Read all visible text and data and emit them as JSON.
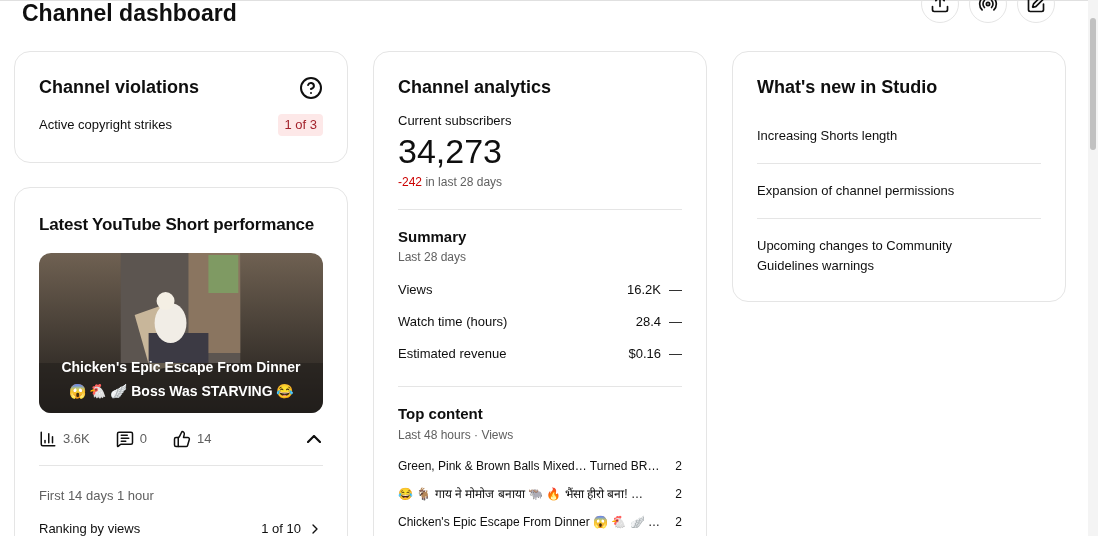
{
  "page_title": "Channel dashboard",
  "header_actions": [
    {
      "kind": "upload"
    },
    {
      "kind": "live"
    },
    {
      "kind": "edit"
    }
  ],
  "violations": {
    "title": "Channel violations",
    "label": "Active copyright strikes",
    "badge": "1 of 3"
  },
  "short": {
    "title": "Latest YouTube Short performance",
    "video_title": "Chicken's Epic Escape From Dinner 😱 🐔 🪽 Boss Was STARVING 😂",
    "stats": [
      {
        "kind": "views",
        "value": "3.6K"
      },
      {
        "kind": "comments",
        "value": "0"
      },
      {
        "kind": "likes",
        "value": "14"
      }
    ],
    "expanded": true,
    "period": "First 14 days 1 hour",
    "ranking_label": "Ranking by views",
    "ranking_value": "1 of 10"
  },
  "analytics": {
    "title": "Channel analytics",
    "subscribers_label": "Current subscribers",
    "subscribers": "34,273",
    "change": "-242",
    "change_suffix": "in last 28 days",
    "summary": {
      "title": "Summary",
      "subtitle": "Last 28 days",
      "rows": [
        {
          "label": "Views",
          "value": "16.2K",
          "trend": "—"
        },
        {
          "label": "Watch time (hours)",
          "value": "28.4",
          "trend": "—"
        },
        {
          "label": "Estimated revenue",
          "value": "$0.16",
          "trend": "—"
        }
      ]
    },
    "top_content": {
      "title": "Top content",
      "subtitle": "Last 48 hours · Views",
      "rows": [
        {
          "title": "Green, Pink & Brown Balls Mixed… Turned BR…",
          "views": "2"
        },
        {
          "title": "😂 🐐 गाय ने मोमोज बनाया 🐃 🔥 भैंसा हीरो बना! …",
          "views": "2"
        },
        {
          "title": "Chicken's Epic Escape From Dinner 😱 🐔 🪽 …",
          "views": "2"
        }
      ]
    }
  },
  "whats_new": {
    "title": "What's new in Studio",
    "items": [
      "Increasing Shorts length",
      "Expansion of channel permissions",
      "Upcoming changes to Community Guidelines warnings"
    ]
  }
}
